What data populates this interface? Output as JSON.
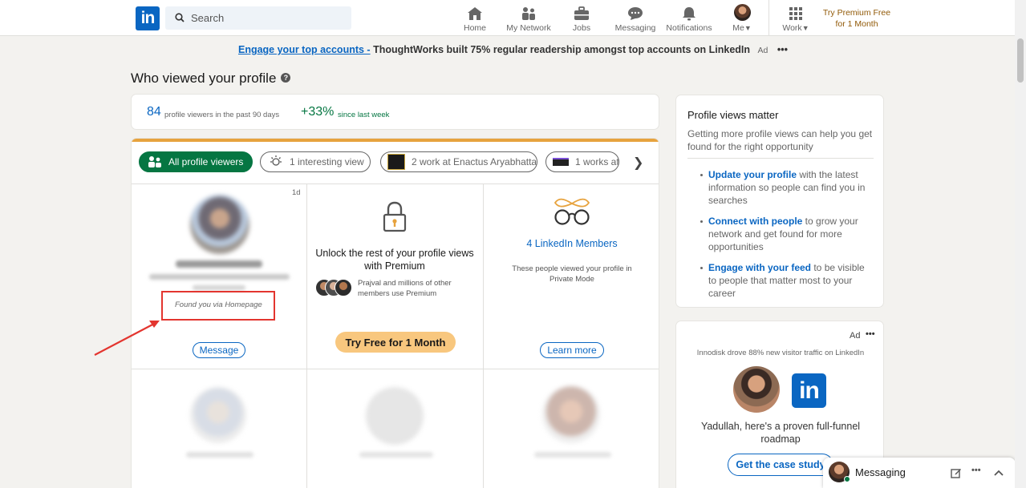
{
  "nav": {
    "logo_text": "in",
    "search_placeholder": "Search",
    "items": [
      {
        "label": "Home",
        "icon": "home-icon"
      },
      {
        "label": "My Network",
        "icon": "network-icon"
      },
      {
        "label": "Jobs",
        "icon": "briefcase-icon"
      },
      {
        "label": "Messaging",
        "icon": "chat-icon"
      },
      {
        "label": "Notifications",
        "icon": "bell-icon"
      },
      {
        "label": "Me",
        "icon": "avatar"
      },
      {
        "label": "Work",
        "icon": "grid-icon"
      }
    ],
    "premium_line1": "Try Premium Free",
    "premium_line2": "for 1 Month"
  },
  "ad_banner": {
    "link": "Engage your top accounts -",
    "text": "ThoughtWorks built 75% regular readership amongst top accounts on LinkedIn",
    "tag": "Ad",
    "more": "•••"
  },
  "page": {
    "title": "Who viewed your profile",
    "help": "?"
  },
  "stats": {
    "viewers_count": "84",
    "viewers_label": "profile viewers in the past 90 days",
    "growth": "+33%",
    "growth_label": "since last week"
  },
  "filters": [
    {
      "label": "All profile viewers",
      "active": true
    },
    {
      "label": "1 interesting view",
      "active": false
    },
    {
      "label": "2 work at Enactus Aryabhatta",
      "active": false
    },
    {
      "label": "1 works at",
      "active": false
    }
  ],
  "viewer_card": {
    "time": "1d",
    "found_via": "Found you via Homepage",
    "message_label": "Message"
  },
  "premium_card": {
    "title": "Unlock the rest of your profile views with Premium",
    "social": "Prajval and millions of other members use Premium",
    "cta": "Try Free for 1 Month"
  },
  "private_card": {
    "title": "4 LinkedIn Members",
    "desc": "These people viewed your profile in Private Mode",
    "cta": "Learn more"
  },
  "sidebar": {
    "title": "Profile views matter",
    "subtitle": "Getting more profile views can help you get found for the right opportunity",
    "tips": [
      {
        "highlight": "Update your profile",
        "text": " with the latest information so people can find you in searches"
      },
      {
        "highlight": "Connect with people",
        "text": " to grow your network and get found for more opportunities"
      },
      {
        "highlight": "Engage with your feed",
        "text": " to be visible to people that matter most to your career"
      }
    ]
  },
  "sidebar_ad": {
    "tag": "Ad",
    "more": "•••",
    "headline": "Innodisk drove 88% new visitor traffic on LinkedIn",
    "logo_text": "in",
    "body": "Yadullah, here's a proven full-funnel roadmap",
    "cta": "Get the case study"
  },
  "messaging": {
    "label": "Messaging"
  },
  "colors": {
    "brand": "#0a66c2",
    "green": "#057642",
    "premium_gold": "#915907",
    "cta_gold": "#f8c77e",
    "annotation": "#e3352f"
  }
}
